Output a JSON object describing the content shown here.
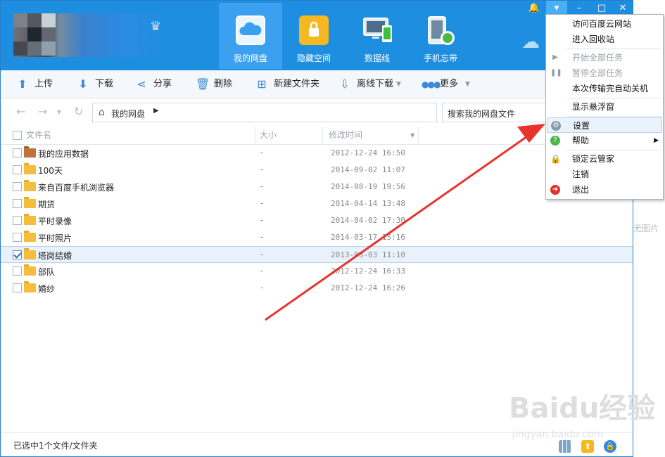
{
  "nav_tabs": [
    {
      "label": "我的网盘"
    },
    {
      "label": "隐藏空间"
    },
    {
      "label": "数据线"
    },
    {
      "label": "手机忘带"
    }
  ],
  "toolbar": {
    "upload": "上传",
    "download": "下载",
    "share": "分享",
    "delete": "删除",
    "new_folder": "新建文件夹",
    "offline_download": "离线下载",
    "more": "更多"
  },
  "address": {
    "path": "我的网盘"
  },
  "search": {
    "placeholder": "搜索我的网盘文件"
  },
  "columns": {
    "name": "文件名",
    "size": "大小",
    "modified": "修改时间"
  },
  "files": [
    {
      "name": "我的应用数据",
      "size": "-",
      "time": "2012-12-24 16:50",
      "checked": false
    },
    {
      "name": "100天",
      "size": "-",
      "time": "2014-09-02 11:07",
      "checked": false
    },
    {
      "name": "来自百度手机浏览器",
      "size": "-",
      "time": "2014-08-19 19:56",
      "checked": false
    },
    {
      "name": "期货",
      "size": "-",
      "time": "2014-04-14 13:48",
      "checked": false
    },
    {
      "name": "平时录像",
      "size": "-",
      "time": "2014-04-02 17:30",
      "checked": false
    },
    {
      "name": "平时照片",
      "size": "-",
      "time": "2014-03-17 15:16",
      "checked": false
    },
    {
      "name": "塔岗结婚",
      "size": "-",
      "time": "2013-03-03 11:10",
      "checked": true
    },
    {
      "name": "部队",
      "size": "-",
      "time": "2012-12-24 16:33",
      "checked": false
    },
    {
      "name": "婚纱",
      "size": "-",
      "time": "2012-12-24 16:26",
      "checked": false
    }
  ],
  "status": {
    "text": "已选中1个文件/文件夹"
  },
  "menu": {
    "items": [
      {
        "label": "访问百度云网站"
      },
      {
        "label": "进入回收站"
      },
      {
        "label": "开始全部任务"
      },
      {
        "label": "暂停全部任务"
      },
      {
        "label": "本次传输完自动关机"
      },
      {
        "label": "显示悬浮窗"
      },
      {
        "label": "设置"
      },
      {
        "label": "帮助"
      },
      {
        "label": "锁定云管家"
      },
      {
        "label": "注销"
      },
      {
        "label": "退出"
      }
    ]
  },
  "watermark": {
    "brand": "Baidu经验",
    "url": "jingyan.baidu.com"
  },
  "background_text": "无图片",
  "colors": {
    "titlebar": "#1e8fe0",
    "active_tab": "#3aa0ef",
    "annotation_arrow": "#e8332e",
    "selected_row": "#e9f2fb"
  }
}
